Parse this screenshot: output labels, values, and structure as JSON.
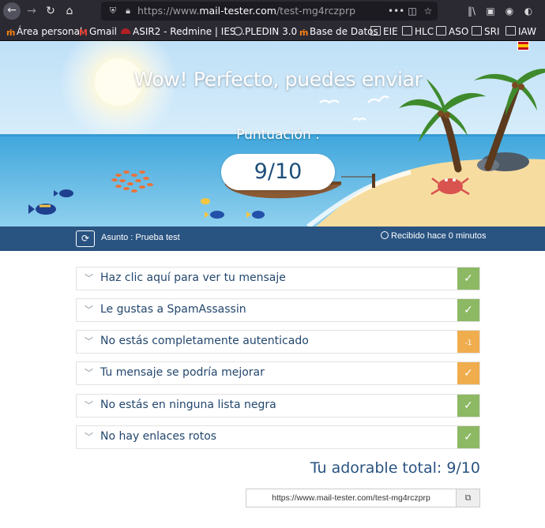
{
  "browser": {
    "url_prefix": "https://www.",
    "url_domain": "mail-tester.com",
    "url_path": "/test-mg4rczprp",
    "icons": [
      "back-icon",
      "forward-icon",
      "reload-icon",
      "home-icon",
      "shield-icon",
      "lock-icon",
      "more-icon",
      "pocket-icon",
      "star-icon",
      "library-icon",
      "sidebar-icon",
      "account-icon",
      "extension-icon"
    ]
  },
  "bookmarks": [
    {
      "label": "Área personal",
      "icon": "moodle-icon"
    },
    {
      "label": "Gmail",
      "icon": "gmail-icon"
    },
    {
      "label": "ASIR2 - Redmine | IES ...",
      "icon": "redmine-icon"
    },
    {
      "label": "PLEDIN 3.0",
      "icon": "globe-icon"
    },
    {
      "label": "Base de Datos",
      "icon": "moodle-icon"
    },
    {
      "label": "EIE",
      "icon": "folder-icon"
    },
    {
      "label": "HLC",
      "icon": "folder-icon"
    },
    {
      "label": "ASO",
      "icon": "folder-icon"
    },
    {
      "label": "SRI",
      "icon": "folder-icon"
    },
    {
      "label": "IAW",
      "icon": "folder-icon"
    }
  ],
  "hero": {
    "title": "Wow! Perfecto, puedes enviar",
    "score_label": "Puntuación :",
    "score": "9/10"
  },
  "subject_bar": {
    "subject": "Asunto : Prueba test",
    "received": "Recibido hace 0 minutos"
  },
  "results": [
    {
      "label": "Haz clic aquí para ver tu mensaje",
      "badge": "✓",
      "status": "green"
    },
    {
      "label": "Le gustas a SpamAssassin",
      "badge": "✓",
      "status": "green"
    },
    {
      "label": "No estás completamente autenticado",
      "badge": "-1",
      "status": "orange"
    },
    {
      "label": "Tu mensaje se podría mejorar",
      "badge": "✓",
      "status": "orange"
    },
    {
      "label": "No estás en ninguna lista negra",
      "badge": "✓",
      "status": "green"
    },
    {
      "label": "No hay enlaces rotos",
      "badge": "✓",
      "status": "green"
    }
  ],
  "total": "Tu adorable total: 9/10",
  "share_link": "https://www.mail-tester.com/test-mg4rczprp",
  "colors": {
    "green": "#8db864",
    "orange": "#f0ad4e",
    "brand": "#295381"
  }
}
